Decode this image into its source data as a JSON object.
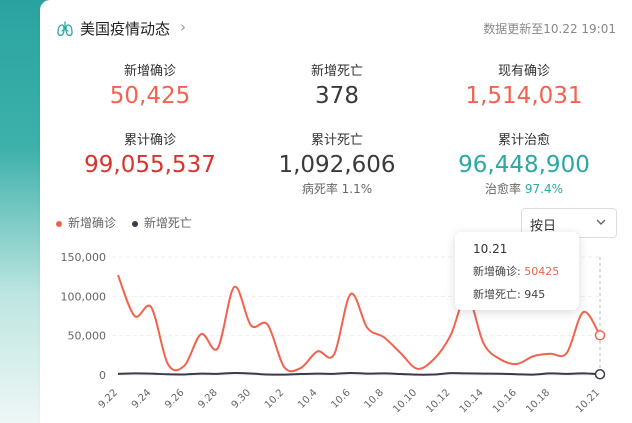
{
  "header": {
    "title": "美国疫情动态",
    "chevron": "›",
    "update": "数据更新至10.22 19:01"
  },
  "stats": {
    "new_confirmed": {
      "label": "新增确诊",
      "value": "50,425",
      "color": "#f2624f"
    },
    "new_deaths": {
      "label": "新增死亡",
      "value": "378",
      "color": "#3a3a3a"
    },
    "current_confirmed": {
      "label": "现有确诊",
      "value": "1,514,031",
      "color": "#f2624f"
    },
    "total_confirmed": {
      "label": "累计确诊",
      "value": "99,055,537",
      "color": "#d9332e"
    },
    "total_deaths": {
      "label": "累计死亡",
      "value": "1,092,606",
      "color": "#3a3a3a",
      "sub_label": "病死率",
      "sub_value": "1.1%"
    },
    "total_cured": {
      "label": "累计治愈",
      "value": "96,448,900",
      "color": "#2aa8a3",
      "sub_label": "治愈率",
      "sub_value": "97.4%"
    }
  },
  "legend": {
    "confirmed": {
      "label": "新增确诊",
      "color": "#f2624f"
    },
    "deaths": {
      "label": "新增死亡",
      "color": "#3a3a4a"
    }
  },
  "select": {
    "value": "按日"
  },
  "tooltip": {
    "date": "10.21",
    "confirmed_label": "新增确诊:",
    "confirmed_value": "50425",
    "deaths_label": "新增死亡:",
    "deaths_value": "945"
  },
  "chart_data": {
    "type": "line",
    "x": [
      "9.22",
      "9.23",
      "9.24",
      "9.25",
      "9.26",
      "9.27",
      "9.28",
      "9.29",
      "9.30",
      "10.1",
      "10.2",
      "10.3",
      "10.4",
      "10.5",
      "10.6",
      "10.7",
      "10.8",
      "10.9",
      "10.10",
      "10.11",
      "10.12",
      "10.13",
      "10.14",
      "10.15",
      "10.16",
      "10.17",
      "10.18",
      "10.19",
      "10.20",
      "10.21"
    ],
    "x_tick_labels": [
      "9.22",
      "9.24",
      "9.26",
      "9.28",
      "9.30",
      "10.2",
      "10.4",
      "10.6",
      "10.8",
      "10.10",
      "10.12",
      "10.14",
      "10.16",
      "10.18",
      "10.21"
    ],
    "series": [
      {
        "name": "新增确诊",
        "color": "#f2624f",
        "values": [
          127000,
          75000,
          86000,
          14000,
          12000,
          52000,
          34000,
          112000,
          63000,
          64000,
          10000,
          9000,
          30000,
          26000,
          103000,
          60000,
          48000,
          28000,
          8000,
          20000,
          50000,
          100000,
          40000,
          20000,
          14000,
          24000,
          27000,
          28000,
          80000,
          50425
        ]
      },
      {
        "name": "新增死亡",
        "color": "#3a3a4a",
        "values": [
          1500,
          2000,
          1800,
          900,
          700,
          1700,
          1500,
          2500,
          1900,
          600,
          500,
          1200,
          1700,
          1500,
          2600,
          1800,
          2000,
          1300,
          400,
          600,
          2400,
          2000,
          1800,
          1600,
          1000,
          500,
          2000,
          1500,
          2000,
          945
        ]
      }
    ],
    "yticks": [
      "0",
      "50,000",
      "100,000",
      "150,000"
    ],
    "ylim": [
      0,
      150000
    ],
    "grid": true
  }
}
